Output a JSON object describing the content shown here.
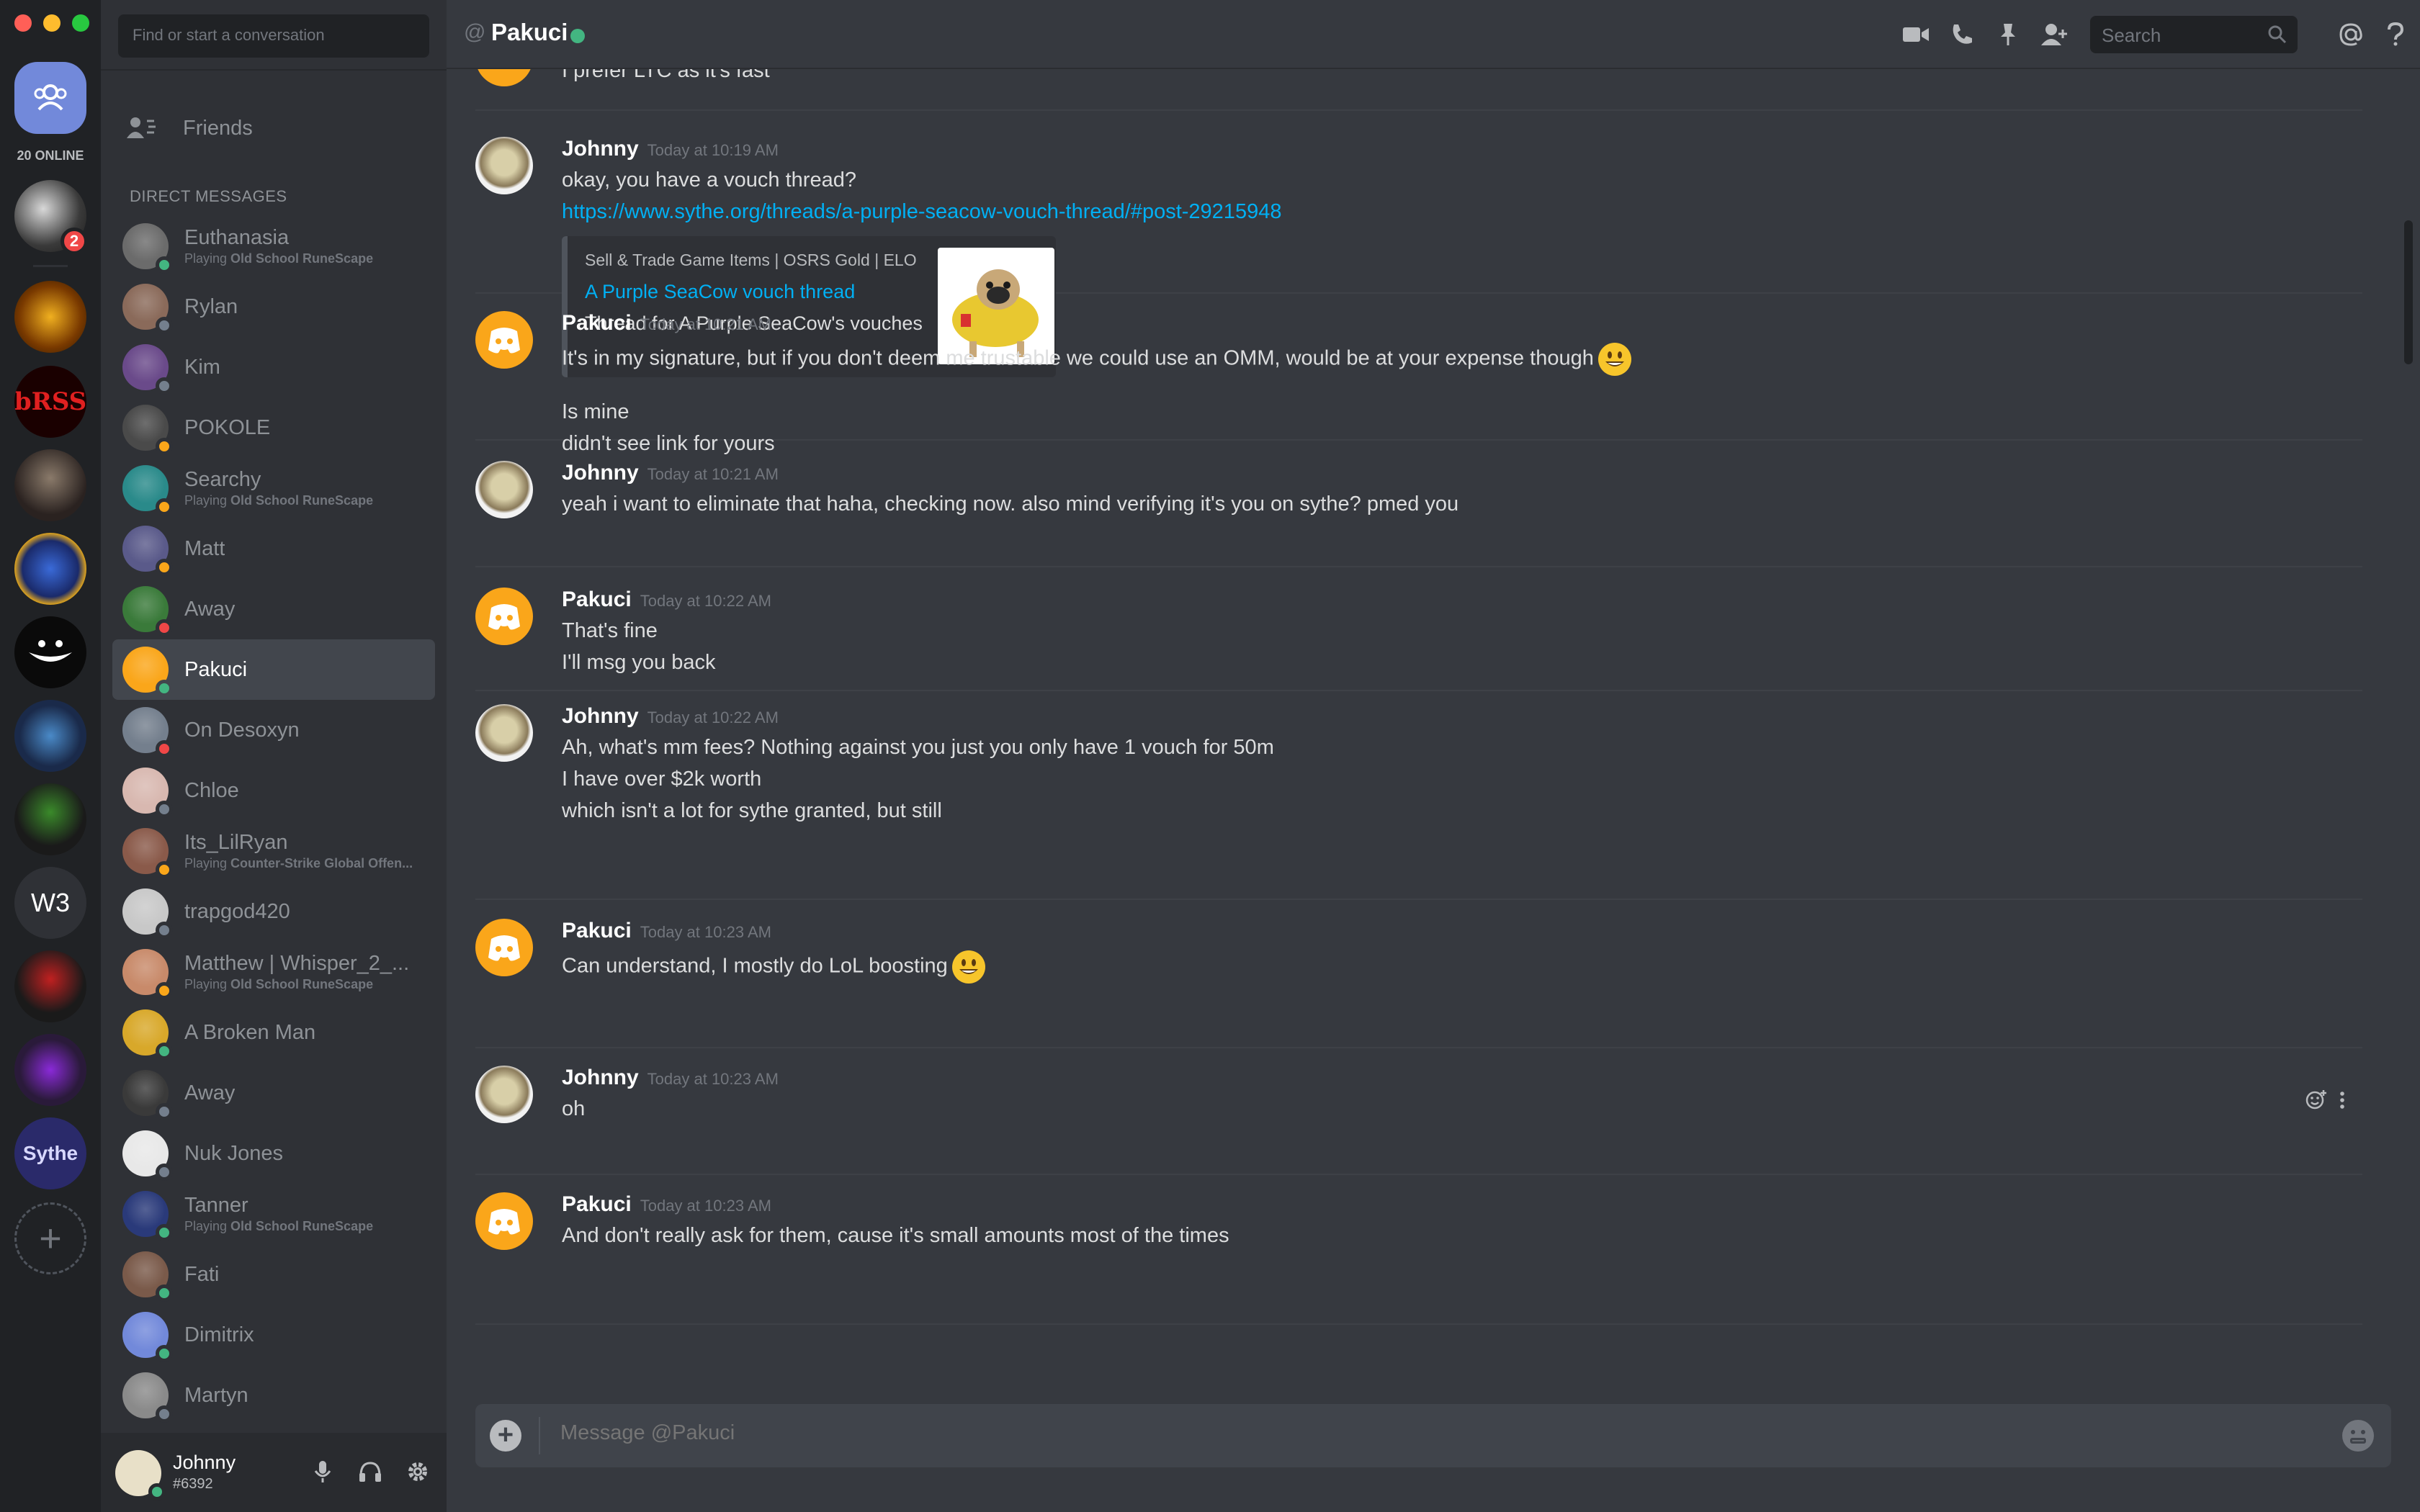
{
  "window": {
    "traffic_colors": [
      "#ff5f57",
      "#febc2e",
      "#28c840"
    ]
  },
  "rail": {
    "online_label": "20 ONLINE",
    "badge_count": "2",
    "w3_label": "W3",
    "sythe_label": "Sythe"
  },
  "dm": {
    "search_placeholder": "Find or start a conversation",
    "friends_label": "Friends",
    "header": "DIRECT MESSAGES",
    "items": [
      {
        "name": "Euthanasia",
        "sub_prefix": "Playing ",
        "sub_game": "Old School RuneScape",
        "status": "#43b581",
        "avatar": "#6b6b6b"
      },
      {
        "name": "Rylan",
        "sub_prefix": "",
        "sub_game": "",
        "status": "#747f8d",
        "avatar": "#8a6a5a"
      },
      {
        "name": "Kim",
        "sub_prefix": "",
        "sub_game": "",
        "status": "#747f8d",
        "avatar": "#6a4a8a"
      },
      {
        "name": "POKOLE",
        "sub_prefix": "",
        "sub_game": "",
        "status": "#faa61a",
        "avatar": "#4a4a4a"
      },
      {
        "name": "Searchy",
        "sub_prefix": "Playing ",
        "sub_game": "Old School RuneScape",
        "status": "#faa61a",
        "avatar": "#2a8a8a"
      },
      {
        "name": "Matt",
        "sub_prefix": "",
        "sub_game": "",
        "status": "#faa61a",
        "avatar": "#5a5a8a"
      },
      {
        "name": "Away",
        "sub_prefix": "",
        "sub_game": "",
        "status": "#f04747",
        "avatar": "#3a7a3a"
      },
      {
        "name": "Pakuci",
        "sub_prefix": "",
        "sub_game": "",
        "status": "#43b581",
        "avatar": "#faa61a"
      },
      {
        "name": "On Desoxyn",
        "sub_prefix": "",
        "sub_game": "",
        "status": "#f04747",
        "avatar": "#747f8d"
      },
      {
        "name": "Chloe",
        "sub_prefix": "",
        "sub_game": "",
        "status": "#747f8d",
        "avatar": "#d8b8b0"
      },
      {
        "name": "Its_LilRyan",
        "sub_prefix": "Playing ",
        "sub_game": "Counter-Strike Global Offen...",
        "status": "#faa61a",
        "avatar": "#8a5a4a"
      },
      {
        "name": "trapgod420",
        "sub_prefix": "",
        "sub_game": "",
        "status": "#747f8d",
        "avatar": "#c8c8c8"
      },
      {
        "name": "Matthew | Whisper_2_...",
        "sub_prefix": "Playing ",
        "sub_game": "Old School RuneScape",
        "status": "#faa61a",
        "avatar": "#c88a6a"
      },
      {
        "name": "A Broken Man",
        "sub_prefix": "",
        "sub_game": "",
        "status": "#43b581",
        "avatar": "#d8a82a"
      },
      {
        "name": "Away",
        "sub_prefix": "",
        "sub_game": "",
        "status": "#747f8d",
        "avatar": "#3a3a3a"
      },
      {
        "name": "Nuk Jones",
        "sub_prefix": "",
        "sub_game": "",
        "status": "#747f8d",
        "avatar": "#e8e8e8"
      },
      {
        "name": "Tanner",
        "sub_prefix": "Playing ",
        "sub_game": "Old School RuneScape",
        "status": "#43b581",
        "avatar": "#2a3a7a"
      },
      {
        "name": "Fati",
        "sub_prefix": "",
        "sub_game": "",
        "status": "#43b581",
        "avatar": "#7a5a4a"
      },
      {
        "name": "Dimitrix",
        "sub_prefix": "",
        "sub_game": "",
        "status": "#43b581",
        "avatar": "#7289da"
      },
      {
        "name": "Martyn",
        "sub_prefix": "",
        "sub_game": "",
        "status": "#747f8d",
        "avatar": "#8a8a8a"
      }
    ]
  },
  "user": {
    "name": "Johnny",
    "tag": "#6392"
  },
  "channel": {
    "at": "@",
    "name": "Pakuci"
  },
  "search": {
    "placeholder": "Search"
  },
  "messages": {
    "partial_line": "I prefer LTC as it's fast",
    "groups": [
      {
        "author": "Johnny",
        "time": "Today at 10:19 AM",
        "lines": [
          "okay, you have a vouch thread?"
        ],
        "link": "https://www.sythe.org/threads/a-purple-seacow-vouch-thread/#post-29215948",
        "embed": {
          "provider": "Sell & Trade Game Items | OSRS Gold | ELO",
          "title": "A Purple SeaCow vouch thread",
          "description": "Thread for A Purple SeaCow's vouches"
        },
        "after": [
          "Is mine",
          "didn't see link for yours"
        ]
      },
      {
        "author": "Pakuci",
        "time": "Today at 10:21 AM",
        "lines": [
          "It's in my signature, but if you don't deem me trustable we could use an OMM, would be at your expense though"
        ]
      },
      {
        "author": "Johnny",
        "time": "Today at 10:21 AM",
        "lines": [
          "yeah i want to eliminate that haha, checking now. also mind verifying it's you on sythe? pmed you"
        ]
      },
      {
        "author": "Pakuci",
        "time": "Today at 10:22 AM",
        "lines": [
          "That's fine",
          "I'll msg you back"
        ]
      },
      {
        "author": "Johnny",
        "time": "Today at 10:22 AM",
        "lines": [
          "Ah, what's mm fees? Nothing against you just you only have 1 vouch for 50m",
          "I have over $2k worth",
          "which isn't a lot for sythe granted, but still"
        ]
      },
      {
        "author": "Pakuci",
        "time": "Today at 10:23 AM",
        "lines": [
          "Can understand, I mostly do LoL boosting"
        ]
      },
      {
        "author": "Johnny",
        "time": "Today at 10:23 AM",
        "lines": [
          "oh"
        ]
      },
      {
        "author": "Pakuci",
        "time": "Today at 10:23 AM",
        "lines": [
          "And don't really ask for them, cause it's small amounts most of the times"
        ]
      }
    ]
  },
  "composer": {
    "placeholder": "Message @Pakuci"
  }
}
